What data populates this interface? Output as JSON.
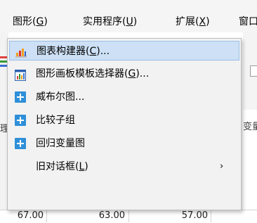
{
  "menubar": {
    "items": [
      {
        "text": "图形(",
        "key": "G",
        "tail": ")"
      },
      {
        "text": "实用程序(",
        "key": "U",
        "tail": ")"
      },
      {
        "text": "扩展(",
        "key": "X",
        "tail": ")"
      },
      {
        "text": "窗口"
      }
    ]
  },
  "background": {
    "cut_text": "变量",
    "left_glyph": "理",
    "row_values": [
      "67.00",
      "63.00",
      "57.00"
    ]
  },
  "dropdown": {
    "items": [
      {
        "text": "图表构建器(",
        "key": "C",
        "tail": ")...",
        "icon": "bar-chart-icon"
      },
      {
        "text": "图形画板模板选择器(",
        "key": "G",
        "tail": ")...",
        "icon": "chart-template-icon"
      },
      {
        "text": "威布尔图...",
        "icon": "plus-icon"
      },
      {
        "text": "比较子组",
        "icon": "plus-icon"
      },
      {
        "text": "回归变量图",
        "icon": "plus-icon"
      },
      {
        "text": "旧对话框(",
        "key": "L",
        "tail": ")",
        "submenu_arrow": "›"
      }
    ]
  },
  "colors": {
    "highlight": "#cde0f5",
    "plus_icon": "#2f8fd8"
  }
}
